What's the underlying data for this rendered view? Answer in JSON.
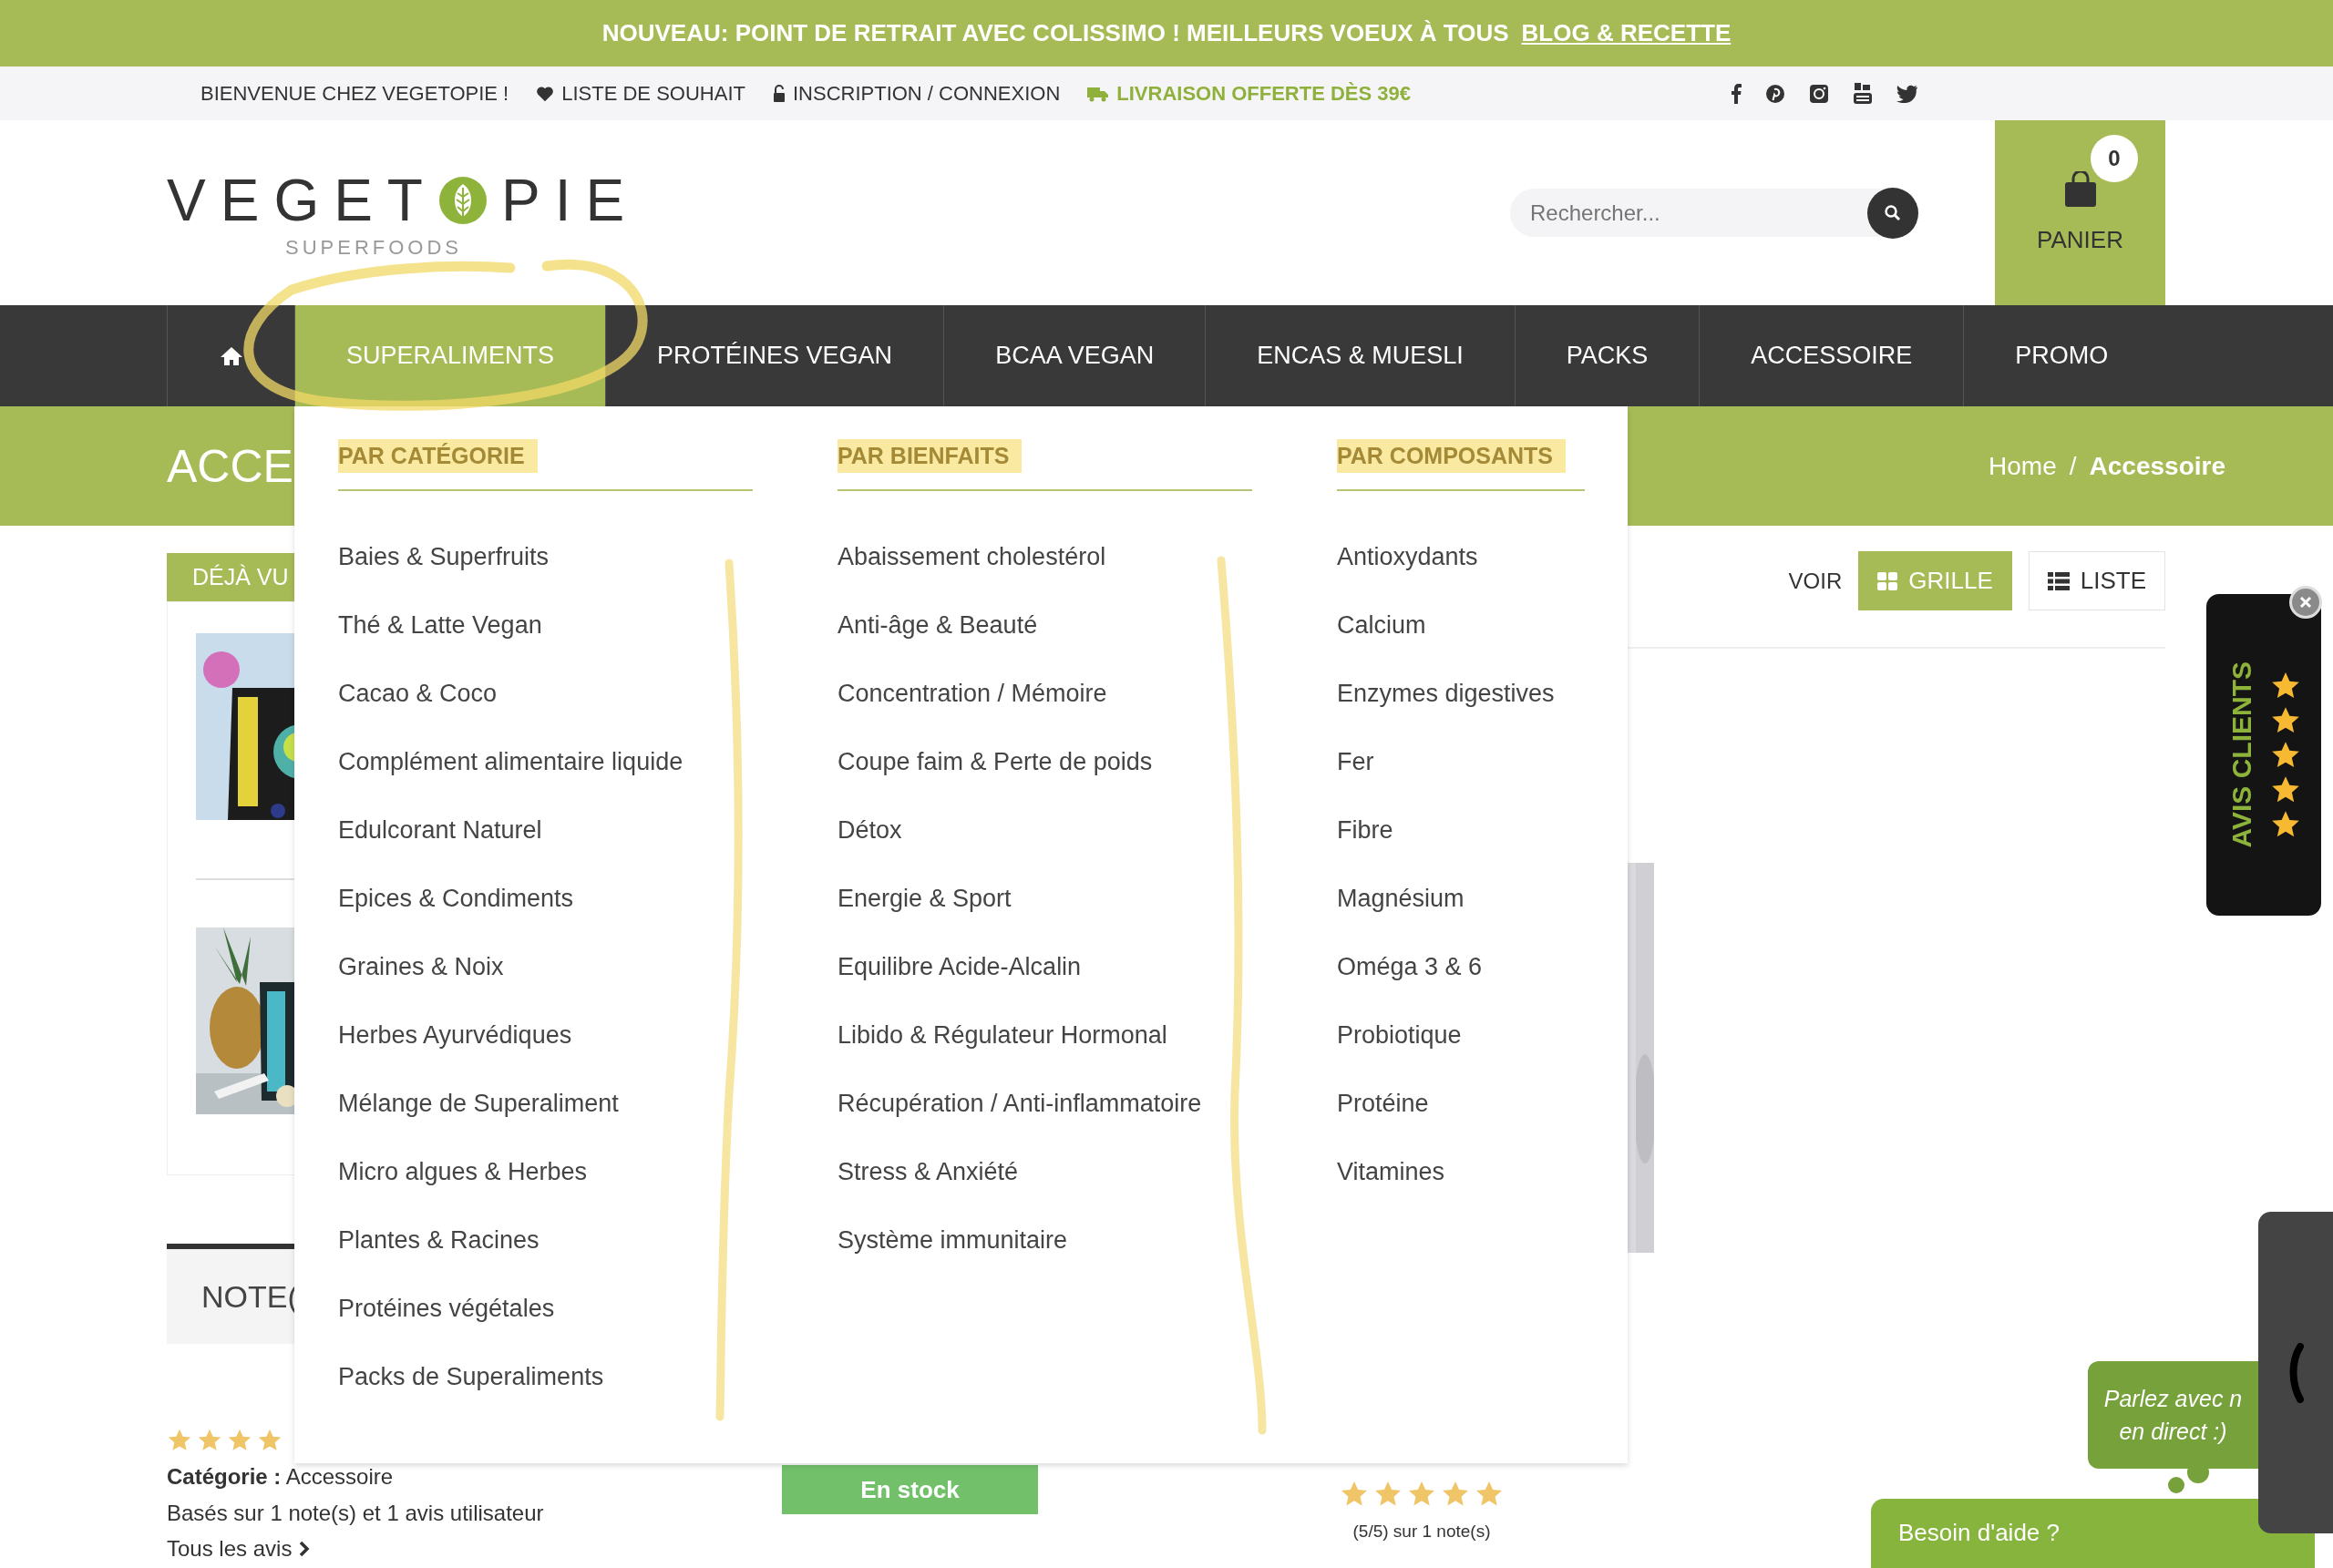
{
  "announcement": {
    "text": "NOUVEAU: POINT DE RETRAIT AVEC COLISSIMO ! MEILLEURS VOEUX À TOUS",
    "link": "BLOG & RECETTE"
  },
  "top_bar": {
    "welcome": "BIENVENUE CHEZ VEGETOPIE !",
    "links": [
      {
        "kind": "wishlist",
        "label": "LISTE DE SOUHAIT"
      },
      {
        "kind": "account",
        "label": "INSCRIPTION / CONNEXION"
      },
      {
        "kind": "shipping",
        "label": "LIVRAISON OFFERTE DÈS 39€"
      }
    ]
  },
  "header": {
    "logo": {
      "text_before": "VEGET",
      "text_after": "PIE",
      "tagline": "SUPERFOODS"
    },
    "search": {
      "placeholder": "Rechercher..."
    },
    "cart": {
      "label": "PANIER",
      "count": "0"
    }
  },
  "nav": [
    {
      "kind": "home",
      "selected": false
    },
    {
      "kind": "link",
      "label": "SUPERALIMENTS",
      "selected": true
    },
    {
      "kind": "link",
      "label": "PROTÉINES VEGAN",
      "selected": false
    },
    {
      "kind": "link",
      "label": "BCAA VEGAN",
      "selected": false
    },
    {
      "kind": "link",
      "label": "ENCAS & MUESLI",
      "selected": false
    },
    {
      "kind": "link",
      "label": "PACKS",
      "selected": false
    },
    {
      "kind": "link",
      "label": "ACCESSOIRE",
      "selected": false
    },
    {
      "kind": "link",
      "label": "PROMO",
      "selected": false
    }
  ],
  "page_title": "ACCE",
  "breadcrumb": {
    "items": [
      "Home",
      "Accessoire"
    ],
    "separator": "/"
  },
  "mega_menu": {
    "columns": [
      {
        "heading": "PAR CATÉGORIE",
        "items": [
          "Baies & Superfruits",
          "Thé & Latte Vegan",
          "Cacao & Coco",
          "Complément alimentaire liquide",
          "Edulcorant Naturel",
          "Epices & Condiments",
          "Graines & Noix",
          "Herbes Ayurvédiques",
          "Mélange de Superaliment",
          "Micro algues & Herbes",
          "Plantes & Racines",
          "Protéines végétales",
          "Packs de Superaliments"
        ]
      },
      {
        "heading": "PAR BIENFAITS",
        "items": [
          "Abaissement cholestérol",
          "Anti-âge & Beauté",
          "Concentration / Mémoire",
          "Coupe faim & Perte de poids",
          "Détox",
          "Energie & Sport",
          "Equilibre Acide-Alcalin",
          "Libido & Régulateur Hormonal",
          "Récupération / Anti-inflammatoire",
          "Stress & Anxiété",
          "Système immunitaire"
        ]
      },
      {
        "heading": "PAR COMPOSANTS",
        "items": [
          "Antioxydants",
          "Calcium",
          "Enzymes digestives",
          "Fer",
          "Fibre",
          "Magnésium",
          "Oméga 3 & 6",
          "Probiotique",
          "Protéine",
          "Vitamines"
        ]
      }
    ]
  },
  "sidebar": {
    "title": "DÉJÀ VU"
  },
  "reviews": {
    "tab": "NOTE(",
    "stars": 4,
    "category": "**Catégorie :** Accessoire",
    "summary": "Basés sur 1 note(s) et 1 avis utilisateur",
    "all_link": "Tous les avis"
  },
  "view": {
    "label": "VOIR",
    "options": [
      {
        "kind": "grid",
        "label": "GRILLE",
        "selected": true
      },
      {
        "kind": "list",
        "label": "LISTE",
        "selected": false
      }
    ]
  },
  "product": {
    "stock": "En stock",
    "stars": 5,
    "rating_text": "(5/5) sur 1 note(s)"
  },
  "reviews_widget": {
    "label": "AVIS CLIENTS"
  },
  "chat": {
    "bubble_lines": [
      "Parlez avec n",
      "en direct :)"
    ],
    "help": "Besoin d'aide ?"
  }
}
